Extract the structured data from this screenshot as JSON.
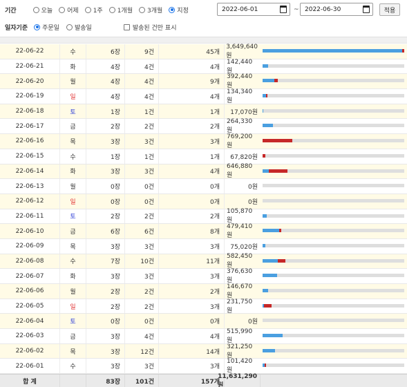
{
  "filter": {
    "period_label": "기간",
    "period_options": [
      "오늘",
      "어제",
      "1주",
      "1개월",
      "3개월",
      "지정"
    ],
    "period_selected": "지정",
    "date_from": "2022-06-01",
    "date_sep": "~",
    "date_to": "2022-06-30",
    "apply_label": "적용",
    "basis_label": "일자기준",
    "basis_options": [
      "주문일",
      "발송일"
    ],
    "basis_selected": "주문일",
    "show_shipped_label": "발송된 건만 표시",
    "show_shipped_checked": false
  },
  "colors": {
    "bar_blue": "#4a9fe0",
    "bar_red": "#c62828",
    "row_highlight": "#fffbe6",
    "sunday": "#e23a3a",
    "saturday": "#2f3fd6"
  },
  "rows": [
    {
      "date": "22-06-22",
      "weekday": "수",
      "jang": "6장",
      "gun": "9건",
      "gae": "45개",
      "amount": "3,649,640원",
      "value": 3649640,
      "blue": 0.985,
      "red": 0.015
    },
    {
      "date": "22-06-21",
      "weekday": "화",
      "jang": "4장",
      "gun": "4건",
      "gae": "4개",
      "amount": "142,440원",
      "value": 142440,
      "blue": 0.04,
      "red": 0
    },
    {
      "date": "22-06-20",
      "weekday": "월",
      "jang": "4장",
      "gun": "4건",
      "gae": "9개",
      "amount": "392,440원",
      "value": 392440,
      "blue": 0.085,
      "red": 0.025
    },
    {
      "date": "22-06-19",
      "weekday": "일",
      "jang": "4장",
      "gun": "4건",
      "gae": "4개",
      "amount": "134,340원",
      "value": 134340,
      "blue": 0.025,
      "red": 0.012
    },
    {
      "date": "22-06-18",
      "weekday": "토",
      "jang": "1장",
      "gun": "1건",
      "gae": "1개",
      "amount": "17,070원",
      "value": 17070,
      "blue": 0.005,
      "red": 0
    },
    {
      "date": "22-06-17",
      "weekday": "금",
      "jang": "2장",
      "gun": "2건",
      "gae": "2개",
      "amount": "264,330원",
      "value": 264330,
      "blue": 0.072,
      "red": 0
    },
    {
      "date": "22-06-16",
      "weekday": "목",
      "jang": "3장",
      "gun": "3건",
      "gae": "3개",
      "amount": "769,200원",
      "value": 769200,
      "blue": 0,
      "red": 0.21
    },
    {
      "date": "22-06-15",
      "weekday": "수",
      "jang": "1장",
      "gun": "1건",
      "gae": "1개",
      "amount": "67,820원",
      "value": 67820,
      "blue": 0,
      "red": 0.018
    },
    {
      "date": "22-06-14",
      "weekday": "화",
      "jang": "3장",
      "gun": "3건",
      "gae": "4개",
      "amount": "646,880원",
      "value": 646880,
      "blue": 0.045,
      "red": 0.132
    },
    {
      "date": "22-06-13",
      "weekday": "월",
      "jang": "0장",
      "gun": "0건",
      "gae": "0개",
      "amount": "0원",
      "value": 0,
      "blue": 0,
      "red": 0
    },
    {
      "date": "22-06-12",
      "weekday": "일",
      "jang": "0장",
      "gun": "0건",
      "gae": "0개",
      "amount": "0원",
      "value": 0,
      "blue": 0,
      "red": 0
    },
    {
      "date": "22-06-11",
      "weekday": "토",
      "jang": "2장",
      "gun": "2건",
      "gae": "2개",
      "amount": "105,870원",
      "value": 105870,
      "blue": 0.029,
      "red": 0
    },
    {
      "date": "22-06-10",
      "weekday": "금",
      "jang": "6장",
      "gun": "6건",
      "gae": "8개",
      "amount": "479,410원",
      "value": 479410,
      "blue": 0.115,
      "red": 0.016
    },
    {
      "date": "22-06-09",
      "weekday": "목",
      "jang": "3장",
      "gun": "3건",
      "gae": "3개",
      "amount": "75,020원",
      "value": 75020,
      "blue": 0.02,
      "red": 0
    },
    {
      "date": "22-06-08",
      "weekday": "수",
      "jang": "7장",
      "gun": "10건",
      "gae": "11개",
      "amount": "582,450원",
      "value": 582450,
      "blue": 0.105,
      "red": 0.055
    },
    {
      "date": "22-06-07",
      "weekday": "화",
      "jang": "3장",
      "gun": "3건",
      "gae": "3개",
      "amount": "376,630원",
      "value": 376630,
      "blue": 0.103,
      "red": 0
    },
    {
      "date": "22-06-06",
      "weekday": "월",
      "jang": "2장",
      "gun": "2건",
      "gae": "2개",
      "amount": "146,670원",
      "value": 146670,
      "blue": 0.04,
      "red": 0
    },
    {
      "date": "22-06-05",
      "weekday": "일",
      "jang": "2장",
      "gun": "2건",
      "gae": "3개",
      "amount": "231,750원",
      "value": 231750,
      "blue": 0.012,
      "red": 0.052
    },
    {
      "date": "22-06-04",
      "weekday": "토",
      "jang": "0장",
      "gun": "0건",
      "gae": "0개",
      "amount": "0원",
      "value": 0,
      "blue": 0,
      "red": 0
    },
    {
      "date": "22-06-03",
      "weekday": "금",
      "jang": "3장",
      "gun": "4건",
      "gae": "4개",
      "amount": "515,990원",
      "value": 515990,
      "blue": 0.141,
      "red": 0
    },
    {
      "date": "22-06-02",
      "weekday": "목",
      "jang": "3장",
      "gun": "12건",
      "gae": "14개",
      "amount": "321,250원",
      "value": 321250,
      "blue": 0.088,
      "red": 0
    },
    {
      "date": "22-06-01",
      "weekday": "수",
      "jang": "3장",
      "gun": "3건",
      "gae": "3개",
      "amount": "101,420원",
      "value": 101420,
      "blue": 0.016,
      "red": 0.012
    }
  ],
  "total": {
    "label": "합 계",
    "jang": "83장",
    "gun": "101건",
    "gae": "157개",
    "amount": "11,631,290원"
  }
}
